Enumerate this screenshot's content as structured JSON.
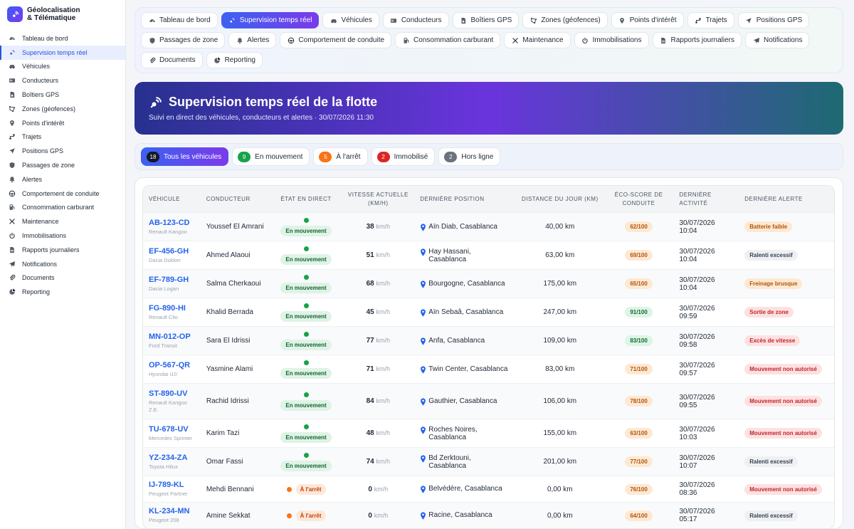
{
  "app": {
    "title_line1": "Géolocalisation",
    "title_line2": "& Télématique"
  },
  "sidebar": {
    "items": [
      {
        "label": "Tableau de bord",
        "icon": "gauge-icon"
      },
      {
        "label": "Supervision temps réel",
        "icon": "satellite-icon",
        "active": true
      },
      {
        "label": "Véhicules",
        "icon": "car-icon"
      },
      {
        "label": "Conducteurs",
        "icon": "id-card-icon"
      },
      {
        "label": "Boîtiers GPS",
        "icon": "sim-card-icon"
      },
      {
        "label": "Zones (géofences)",
        "icon": "draw-polygon-icon"
      },
      {
        "label": "Points d'intérêt",
        "icon": "map-pin-icon"
      },
      {
        "label": "Trajets",
        "icon": "route-icon"
      },
      {
        "label": "Positions GPS",
        "icon": "location-arrow-icon"
      },
      {
        "label": "Passages de zone",
        "icon": "shield-icon"
      },
      {
        "label": "Alertes",
        "icon": "bell-icon"
      },
      {
        "label": "Comportement de conduite",
        "icon": "steering-icon"
      },
      {
        "label": "Consommation carburant",
        "icon": "fuel-icon"
      },
      {
        "label": "Maintenance",
        "icon": "tools-icon"
      },
      {
        "label": "Immobilisations",
        "icon": "power-icon"
      },
      {
        "label": "Rapports journaliers",
        "icon": "file-icon"
      },
      {
        "label": "Notifications",
        "icon": "paper-plane-icon"
      },
      {
        "label": "Documents",
        "icon": "paperclip-icon"
      },
      {
        "label": "Reporting",
        "icon": "pie-chart-icon"
      }
    ]
  },
  "tabs": [
    {
      "label": "Tableau de bord",
      "icon": "gauge-icon"
    },
    {
      "label": "Supervision temps réel",
      "icon": "satellite-icon",
      "active": true
    },
    {
      "label": "Véhicules",
      "icon": "car-icon"
    },
    {
      "label": "Conducteurs",
      "icon": "id-card-icon"
    },
    {
      "label": "Boîtiers GPS",
      "icon": "sim-card-icon"
    },
    {
      "label": "Zones (géofences)",
      "icon": "draw-polygon-icon"
    },
    {
      "label": "Points d'intérêt",
      "icon": "map-pin-icon"
    },
    {
      "label": "Trajets",
      "icon": "route-icon"
    },
    {
      "label": "Positions GPS",
      "icon": "location-arrow-icon"
    },
    {
      "label": "Passages de zone",
      "icon": "shield-icon"
    },
    {
      "label": "Alertes",
      "icon": "bell-icon"
    },
    {
      "label": "Comportement de conduite",
      "icon": "steering-icon"
    },
    {
      "label": "Consommation carburant",
      "icon": "fuel-icon"
    },
    {
      "label": "Maintenance",
      "icon": "tools-icon"
    },
    {
      "label": "Immobilisations",
      "icon": "power-icon"
    },
    {
      "label": "Rapports journaliers",
      "icon": "file-icon"
    },
    {
      "label": "Notifications",
      "icon": "paper-plane-icon"
    },
    {
      "label": "Documents",
      "icon": "paperclip-icon"
    },
    {
      "label": "Reporting",
      "icon": "pie-chart-icon"
    }
  ],
  "hero": {
    "title": "Supervision temps réel de la flotte",
    "subtitle": "Suivi en direct des véhicules, conducteurs et alertes · 30/07/2026 11:30"
  },
  "filters": [
    {
      "count": "18",
      "label": "Tous les véhicules",
      "color": "#111827",
      "active": true
    },
    {
      "count": "9",
      "label": "En mouvement",
      "color": "#16a34a"
    },
    {
      "count": "5",
      "label": "À l'arrêt",
      "color": "#f97316"
    },
    {
      "count": "2",
      "label": "Immobilisé",
      "color": "#dc2626"
    },
    {
      "count": "2",
      "label": "Hors ligne",
      "color": "#6b7280"
    }
  ],
  "table": {
    "headers": [
      "Véhicule",
      "Conducteur",
      "État en direct",
      "Vitesse actuelle (km/h)",
      "Dernière position",
      "Distance du jour (km)",
      "Éco-score de conduite",
      "Dernière activité",
      "Dernière alerte"
    ],
    "speed_unit": "km/h",
    "rows": [
      {
        "plate": "AB-123-CD",
        "model": "Renault Kangoo",
        "driver": "Youssef El Amrani",
        "status": "En mouvement",
        "state": "move",
        "speed": "38",
        "position": "Aïn Diab, Casablanca",
        "distance": "40,00 km",
        "eco": "62/100",
        "eco_level": "mid",
        "date": "30/07/2026",
        "time": "10:04",
        "alert": "Batterie faible",
        "alert_level": "warn"
      },
      {
        "plate": "EF-456-GH",
        "model": "Dacia Dokker",
        "driver": "Ahmed Alaoui",
        "status": "En mouvement",
        "state": "move",
        "speed": "51",
        "position": "Hay Hassani, Casablanca",
        "distance": "63,00 km",
        "eco": "69/100",
        "eco_level": "mid",
        "date": "30/07/2026",
        "time": "10:04",
        "alert": "Ralenti excessif",
        "alert_level": "grey"
      },
      {
        "plate": "EF-789-GH",
        "model": "Dacia Logan",
        "driver": "Salma Cherkaoui",
        "status": "En mouvement",
        "state": "move",
        "speed": "68",
        "position": "Bourgogne, Casablanca",
        "distance": "175,00 km",
        "eco": "65/100",
        "eco_level": "mid",
        "date": "30/07/2026",
        "time": "10:04",
        "alert": "Freinage brusque",
        "alert_level": "warn"
      },
      {
        "plate": "FG-890-HI",
        "model": "Renault Clio",
        "driver": "Khalid Berrada",
        "status": "En mouvement",
        "state": "move",
        "speed": "45",
        "position": "Aïn Sebaâ, Casablanca",
        "distance": "247,00 km",
        "eco": "91/100",
        "eco_level": "good",
        "date": "30/07/2026",
        "time": "09:59",
        "alert": "Sortie de zone",
        "alert_level": "red"
      },
      {
        "plate": "MN-012-OP",
        "model": "Ford Transit",
        "driver": "Sara El Idrissi",
        "status": "En mouvement",
        "state": "move",
        "speed": "77",
        "position": "Anfa, Casablanca",
        "distance": "109,00 km",
        "eco": "83/100",
        "eco_level": "good",
        "date": "30/07/2026",
        "time": "09:58",
        "alert": "Excès de vitesse",
        "alert_level": "red"
      },
      {
        "plate": "OP-567-QR",
        "model": "Hyundai i10",
        "driver": "Yasmine Alami",
        "status": "En mouvement",
        "state": "move",
        "speed": "71",
        "position": "Twin Center, Casablanca",
        "distance": "83,00 km",
        "eco": "71/100",
        "eco_level": "mid",
        "date": "30/07/2026",
        "time": "09:57",
        "alert": "Mouvement non autorisé",
        "alert_level": "red"
      },
      {
        "plate": "ST-890-UV",
        "model": "Renault Kangoo Z.E.",
        "driver": "Rachid Idrissi",
        "status": "En mouvement",
        "state": "move",
        "speed": "84",
        "position": "Gauthier, Casablanca",
        "distance": "106,00 km",
        "eco": "78/100",
        "eco_level": "mid",
        "date": "30/07/2026",
        "time": "09:55",
        "alert": "Mouvement non autorisé",
        "alert_level": "red"
      },
      {
        "plate": "TU-678-UV",
        "model": "Mercedes Sprinter",
        "driver": "Karim Tazi",
        "status": "En mouvement",
        "state": "move",
        "speed": "48",
        "position": "Roches Noires, Casablanca",
        "distance": "155,00 km",
        "eco": "63/100",
        "eco_level": "mid",
        "date": "30/07/2026",
        "time": "10:03",
        "alert": "Mouvement non autorisé",
        "alert_level": "red"
      },
      {
        "plate": "YZ-234-ZA",
        "model": "Toyota Hilux",
        "driver": "Omar Fassi",
        "status": "En mouvement",
        "state": "move",
        "speed": "74",
        "position": "Bd Zerktouni, Casablanca",
        "distance": "201,00 km",
        "eco": "77/100",
        "eco_level": "mid",
        "date": "30/07/2026",
        "time": "10:07",
        "alert": "Ralenti excessif",
        "alert_level": "grey"
      },
      {
        "plate": "IJ-789-KL",
        "model": "Peugeot Partner",
        "driver": "Mehdi Bennani",
        "status": "À l'arrêt",
        "state": "stop",
        "speed": "0",
        "position": "Belvédère, Casablanca",
        "distance": "0,00 km",
        "eco": "76/100",
        "eco_level": "mid",
        "date": "30/07/2026",
        "time": "08:36",
        "alert": "Mouvement non autorisé",
        "alert_level": "red"
      },
      {
        "plate": "KL-234-MN",
        "model": "Peugeot 208",
        "driver": "Amine Sekkat",
        "status": "À l'arrêt",
        "state": "stop",
        "speed": "0",
        "position": "Racine, Casablanca",
        "distance": "0,00 km",
        "eco": "64/100",
        "eco_level": "mid",
        "date": "30/07/2026",
        "time": "05:17",
        "alert": "Ralenti excessif",
        "alert_level": "grey"
      }
    ]
  }
}
